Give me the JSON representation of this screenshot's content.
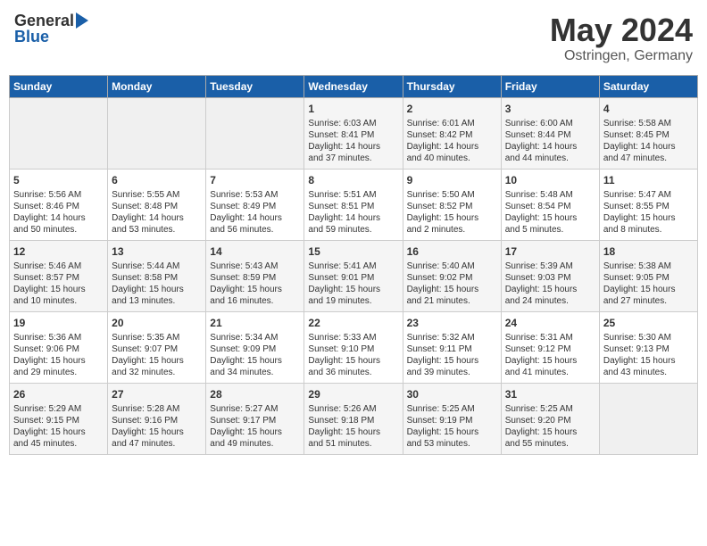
{
  "header": {
    "logo_general": "General",
    "logo_blue": "Blue",
    "title": "May 2024",
    "subtitle": "Ostringen, Germany"
  },
  "calendar": {
    "days_of_week": [
      "Sunday",
      "Monday",
      "Tuesday",
      "Wednesday",
      "Thursday",
      "Friday",
      "Saturday"
    ],
    "weeks": [
      [
        {
          "day": "",
          "info": ""
        },
        {
          "day": "",
          "info": ""
        },
        {
          "day": "",
          "info": ""
        },
        {
          "day": "1",
          "info": "Sunrise: 6:03 AM\nSunset: 8:41 PM\nDaylight: 14 hours\nand 37 minutes."
        },
        {
          "day": "2",
          "info": "Sunrise: 6:01 AM\nSunset: 8:42 PM\nDaylight: 14 hours\nand 40 minutes."
        },
        {
          "day": "3",
          "info": "Sunrise: 6:00 AM\nSunset: 8:44 PM\nDaylight: 14 hours\nand 44 minutes."
        },
        {
          "day": "4",
          "info": "Sunrise: 5:58 AM\nSunset: 8:45 PM\nDaylight: 14 hours\nand 47 minutes."
        }
      ],
      [
        {
          "day": "5",
          "info": "Sunrise: 5:56 AM\nSunset: 8:46 PM\nDaylight: 14 hours\nand 50 minutes."
        },
        {
          "day": "6",
          "info": "Sunrise: 5:55 AM\nSunset: 8:48 PM\nDaylight: 14 hours\nand 53 minutes."
        },
        {
          "day": "7",
          "info": "Sunrise: 5:53 AM\nSunset: 8:49 PM\nDaylight: 14 hours\nand 56 minutes."
        },
        {
          "day": "8",
          "info": "Sunrise: 5:51 AM\nSunset: 8:51 PM\nDaylight: 14 hours\nand 59 minutes."
        },
        {
          "day": "9",
          "info": "Sunrise: 5:50 AM\nSunset: 8:52 PM\nDaylight: 15 hours\nand 2 minutes."
        },
        {
          "day": "10",
          "info": "Sunrise: 5:48 AM\nSunset: 8:54 PM\nDaylight: 15 hours\nand 5 minutes."
        },
        {
          "day": "11",
          "info": "Sunrise: 5:47 AM\nSunset: 8:55 PM\nDaylight: 15 hours\nand 8 minutes."
        }
      ],
      [
        {
          "day": "12",
          "info": "Sunrise: 5:46 AM\nSunset: 8:57 PM\nDaylight: 15 hours\nand 10 minutes."
        },
        {
          "day": "13",
          "info": "Sunrise: 5:44 AM\nSunset: 8:58 PM\nDaylight: 15 hours\nand 13 minutes."
        },
        {
          "day": "14",
          "info": "Sunrise: 5:43 AM\nSunset: 8:59 PM\nDaylight: 15 hours\nand 16 minutes."
        },
        {
          "day": "15",
          "info": "Sunrise: 5:41 AM\nSunset: 9:01 PM\nDaylight: 15 hours\nand 19 minutes."
        },
        {
          "day": "16",
          "info": "Sunrise: 5:40 AM\nSunset: 9:02 PM\nDaylight: 15 hours\nand 21 minutes."
        },
        {
          "day": "17",
          "info": "Sunrise: 5:39 AM\nSunset: 9:03 PM\nDaylight: 15 hours\nand 24 minutes."
        },
        {
          "day": "18",
          "info": "Sunrise: 5:38 AM\nSunset: 9:05 PM\nDaylight: 15 hours\nand 27 minutes."
        }
      ],
      [
        {
          "day": "19",
          "info": "Sunrise: 5:36 AM\nSunset: 9:06 PM\nDaylight: 15 hours\nand 29 minutes."
        },
        {
          "day": "20",
          "info": "Sunrise: 5:35 AM\nSunset: 9:07 PM\nDaylight: 15 hours\nand 32 minutes."
        },
        {
          "day": "21",
          "info": "Sunrise: 5:34 AM\nSunset: 9:09 PM\nDaylight: 15 hours\nand 34 minutes."
        },
        {
          "day": "22",
          "info": "Sunrise: 5:33 AM\nSunset: 9:10 PM\nDaylight: 15 hours\nand 36 minutes."
        },
        {
          "day": "23",
          "info": "Sunrise: 5:32 AM\nSunset: 9:11 PM\nDaylight: 15 hours\nand 39 minutes."
        },
        {
          "day": "24",
          "info": "Sunrise: 5:31 AM\nSunset: 9:12 PM\nDaylight: 15 hours\nand 41 minutes."
        },
        {
          "day": "25",
          "info": "Sunrise: 5:30 AM\nSunset: 9:13 PM\nDaylight: 15 hours\nand 43 minutes."
        }
      ],
      [
        {
          "day": "26",
          "info": "Sunrise: 5:29 AM\nSunset: 9:15 PM\nDaylight: 15 hours\nand 45 minutes."
        },
        {
          "day": "27",
          "info": "Sunrise: 5:28 AM\nSunset: 9:16 PM\nDaylight: 15 hours\nand 47 minutes."
        },
        {
          "day": "28",
          "info": "Sunrise: 5:27 AM\nSunset: 9:17 PM\nDaylight: 15 hours\nand 49 minutes."
        },
        {
          "day": "29",
          "info": "Sunrise: 5:26 AM\nSunset: 9:18 PM\nDaylight: 15 hours\nand 51 minutes."
        },
        {
          "day": "30",
          "info": "Sunrise: 5:25 AM\nSunset: 9:19 PM\nDaylight: 15 hours\nand 53 minutes."
        },
        {
          "day": "31",
          "info": "Sunrise: 5:25 AM\nSunset: 9:20 PM\nDaylight: 15 hours\nand 55 minutes."
        },
        {
          "day": "",
          "info": ""
        }
      ]
    ]
  }
}
